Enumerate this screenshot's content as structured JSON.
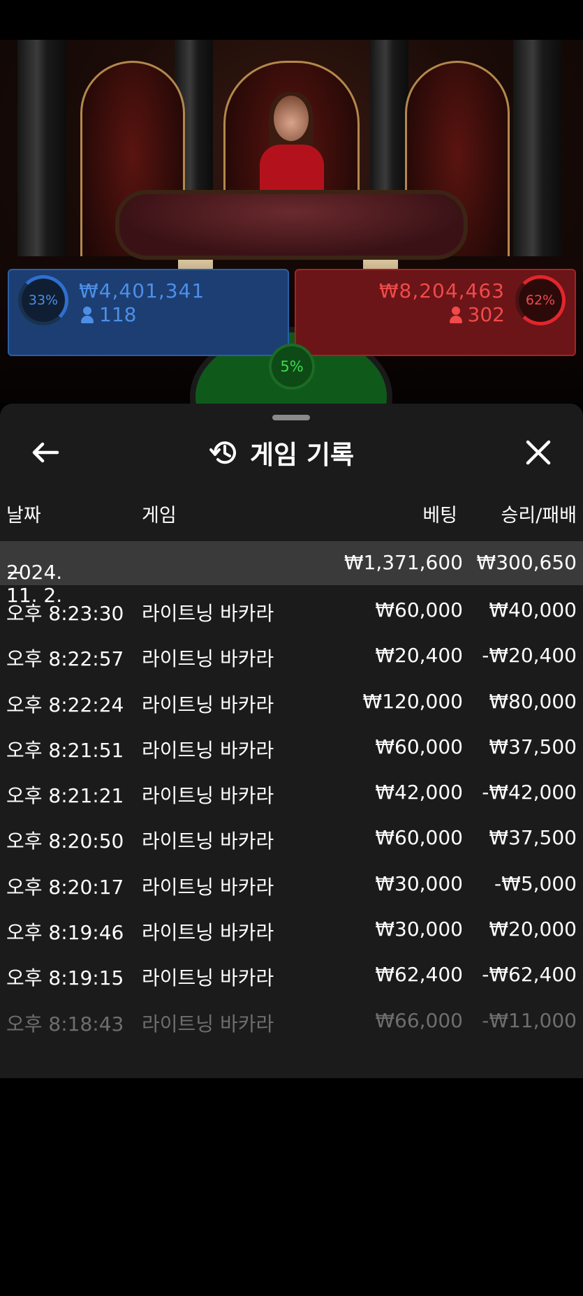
{
  "colors": {
    "player_blue": "#4d8fe6",
    "banker_red": "#f04a4a",
    "tie_green": "#3ddc52",
    "sheet_bg": "#1b1b1b",
    "date_row_bg": "#3a3a3a"
  },
  "betting": {
    "player": {
      "percent": "33%",
      "amount": "₩4,401,341",
      "players": "118"
    },
    "banker": {
      "percent": "62%",
      "amount": "₩8,204,463",
      "players": "302"
    },
    "tie": {
      "percent": "5%"
    }
  },
  "sheet": {
    "title": "게임 기록",
    "icons": {
      "back": "arrow-left-icon",
      "history": "history-icon",
      "close": "close-icon"
    },
    "columns": {
      "date": "날짜",
      "game": "게임",
      "bet": "베팅",
      "win_loss": "승리/패배"
    },
    "date_group": {
      "toggle": "−",
      "date": "2024. 11. 2.",
      "bet_total": "₩1,371,600",
      "win_total": "₩300,650"
    },
    "rows": [
      {
        "time": "오후 8:23:30",
        "game": "라이트닝 바카라",
        "bet": "₩60,000",
        "win": "₩40,000"
      },
      {
        "time": "오후 8:22:57",
        "game": "라이트닝 바카라",
        "bet": "₩20,400",
        "win": "-₩20,400"
      },
      {
        "time": "오후 8:22:24",
        "game": "라이트닝 바카라",
        "bet": "₩120,000",
        "win": "₩80,000"
      },
      {
        "time": "오후 8:21:51",
        "game": "라이트닝 바카라",
        "bet": "₩60,000",
        "win": "₩37,500"
      },
      {
        "time": "오후 8:21:21",
        "game": "라이트닝 바카라",
        "bet": "₩42,000",
        "win": "-₩42,000"
      },
      {
        "time": "오후 8:20:50",
        "game": "라이트닝 바카라",
        "bet": "₩60,000",
        "win": "₩37,500"
      },
      {
        "time": "오후 8:20:17",
        "game": "라이트닝 바카라",
        "bet": "₩30,000",
        "win": "-₩5,000"
      },
      {
        "time": "오후 8:19:46",
        "game": "라이트닝 바카라",
        "bet": "₩30,000",
        "win": "₩20,000"
      },
      {
        "time": "오후 8:19:15",
        "game": "라이트닝 바카라",
        "bet": "₩62,400",
        "win": "-₩62,400"
      },
      {
        "time": "오후 8:18:43",
        "game": "라이트닝 바카라",
        "bet": "₩66,000",
        "win": "-₩11,000"
      }
    ]
  }
}
